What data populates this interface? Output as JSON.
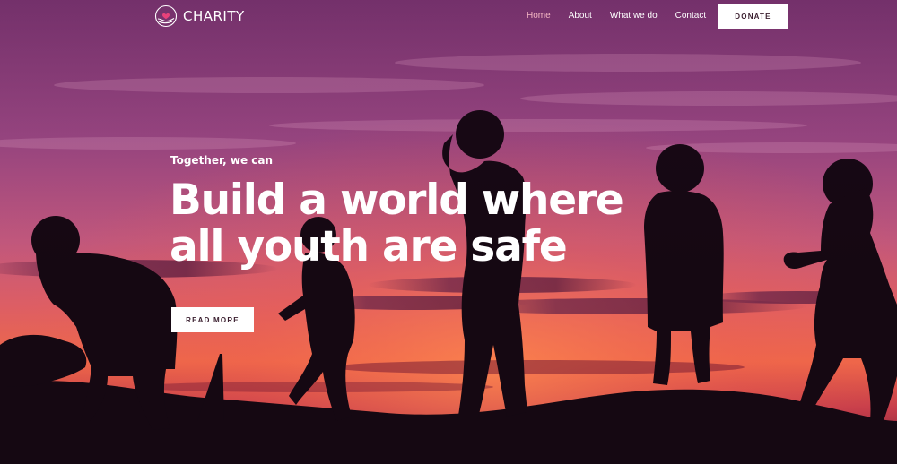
{
  "brand": {
    "name": "CHARITY",
    "logo_icon": "heart-in-hand-icon"
  },
  "nav": {
    "items": [
      {
        "label": "Home",
        "active": true
      },
      {
        "label": "About",
        "active": false
      },
      {
        "label": "What we do",
        "active": false
      },
      {
        "label": "Contact",
        "active": false
      }
    ],
    "donate_label": "DONATE"
  },
  "hero": {
    "tagline": "Together, we can",
    "headline_line1": "Build a world where",
    "headline_line2": "all youth are safe",
    "cta_label": "READ MORE",
    "image": "children silhouettes at sunset"
  },
  "colors": {
    "sky_top": "#8a3a78",
    "sky_mid": "#c0507a",
    "sky_glow": "#f06a4a",
    "silhouette": "#150812",
    "nav_active": "#f5b7c4",
    "button_bg": "#ffffff",
    "button_text": "#3a1e2e"
  }
}
